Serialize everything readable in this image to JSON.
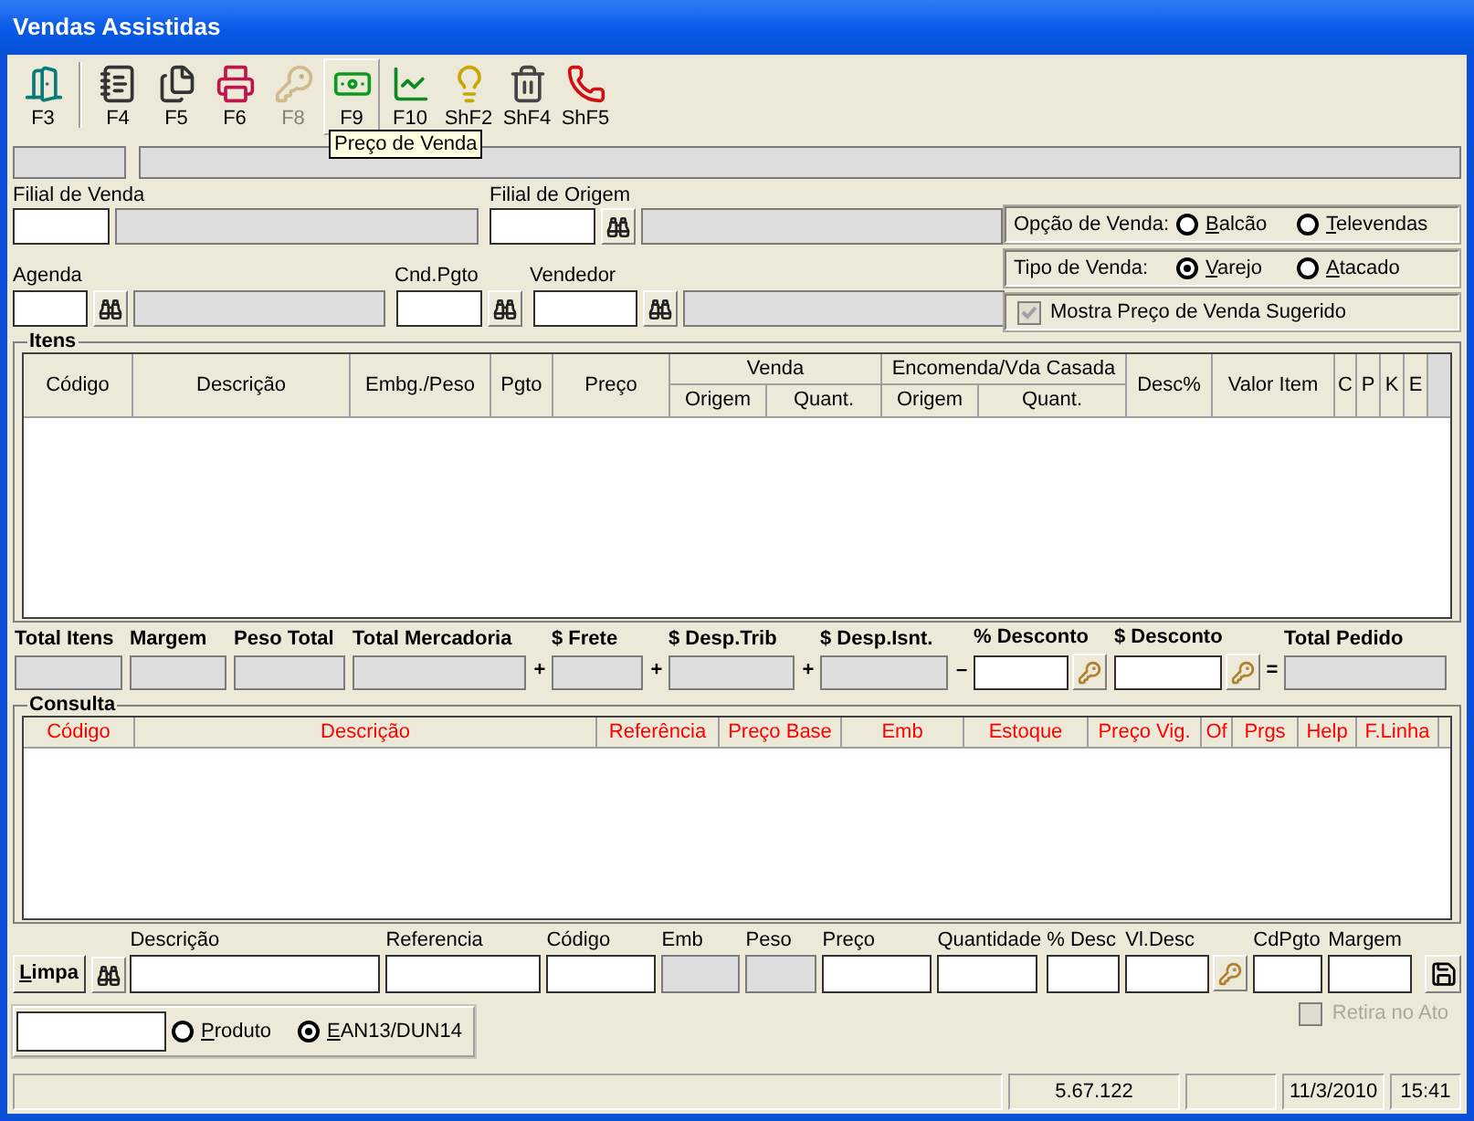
{
  "window": {
    "title": "Vendas Assistidas"
  },
  "toolbar": [
    {
      "label": "F3",
      "disabled": false,
      "hovered": false
    },
    {
      "label": "F4",
      "disabled": false,
      "hovered": false
    },
    {
      "label": "F5",
      "disabled": false,
      "hovered": false
    },
    {
      "label": "F6",
      "disabled": false,
      "hovered": false
    },
    {
      "label": "F8",
      "disabled": true,
      "hovered": false
    },
    {
      "label": "F9",
      "disabled": false,
      "hovered": true
    },
    {
      "label": "F10",
      "disabled": false,
      "hovered": false
    },
    {
      "label": "ShF2",
      "disabled": false,
      "hovered": false
    },
    {
      "label": "ShF4",
      "disabled": false,
      "hovered": false
    },
    {
      "label": "ShF5",
      "disabled": false,
      "hovered": false
    }
  ],
  "tooltip": "Preço de Venda",
  "filial_venda": {
    "label": "Filial de Venda"
  },
  "filial_origem": {
    "label": "Filial de Origem"
  },
  "agenda": {
    "label": "Agenda"
  },
  "cnd_pgto": {
    "label": "Cnd.Pgto"
  },
  "vendedor": {
    "label": "Vendedor"
  },
  "opcao_venda": {
    "label": "Opção de Venda:",
    "options": [
      {
        "label": "Balcão",
        "selected": false
      },
      {
        "label": "Televendas",
        "selected": false
      }
    ]
  },
  "tipo_venda": {
    "label": "Tipo de Venda:",
    "options": [
      {
        "label": "Varejo",
        "selected": true
      },
      {
        "label": "Atacado",
        "selected": false
      }
    ]
  },
  "mostra_preco": {
    "label": "Mostra Preço de Venda Sugerido",
    "checked": true,
    "disabled": true
  },
  "itens": {
    "title": "Itens",
    "columns": [
      {
        "label": "Código"
      },
      {
        "label": "Descrição"
      },
      {
        "label": "Embg./Peso"
      },
      {
        "label": "Pgto"
      },
      {
        "label": "Preço"
      },
      {
        "label": "Venda",
        "children": [
          {
            "label": "Origem"
          },
          {
            "label": "Quant."
          }
        ]
      },
      {
        "label": "Encomenda/Vda Casada",
        "children": [
          {
            "label": "Origem"
          },
          {
            "label": "Quant."
          }
        ]
      },
      {
        "label": "Desc%"
      },
      {
        "label": "Valor Item"
      },
      {
        "label": "C"
      },
      {
        "label": "P"
      },
      {
        "label": "K"
      },
      {
        "label": "E"
      }
    ]
  },
  "totals": [
    {
      "label": "Total Itens",
      "kind": "readonly"
    },
    {
      "label": "Margem",
      "kind": "readonly"
    },
    {
      "label": "Peso Total",
      "kind": "readonly"
    },
    {
      "label": "Total Mercadoria",
      "kind": "readonly"
    },
    {
      "label": "$ Frete",
      "kind": "readonly",
      "operator": "+"
    },
    {
      "label": "$ Desp.Trib",
      "kind": "readonly",
      "operator": "+"
    },
    {
      "label": "$ Desp.Isnt.",
      "kind": "readonly",
      "operator": "+"
    },
    {
      "label": "% Desconto",
      "kind": "input_key",
      "operator": "–"
    },
    {
      "label": "$ Desconto",
      "kind": "input_key"
    },
    {
      "label": "Total Pedido",
      "kind": "readonly",
      "operator": "="
    }
  ],
  "consulta": {
    "title": "Consulta",
    "columns": [
      {
        "label": "Código"
      },
      {
        "label": "Descrição"
      },
      {
        "label": "Referência"
      },
      {
        "label": "Preço Base"
      },
      {
        "label": "Emb"
      },
      {
        "label": "Estoque"
      },
      {
        "label": "Preço Vig."
      },
      {
        "label": "Of"
      },
      {
        "label": "Prgs"
      },
      {
        "label": "Help"
      },
      {
        "label": "F.Linha"
      }
    ]
  },
  "entry": {
    "button": "Limpa",
    "fields": [
      {
        "label": "Descrição",
        "kind": "input"
      },
      {
        "label": "Referencia",
        "kind": "input"
      },
      {
        "label": "Código",
        "kind": "input"
      },
      {
        "label": "Emb",
        "kind": "readonly"
      },
      {
        "label": "Peso",
        "kind": "readonly"
      },
      {
        "label": "Preço",
        "kind": "input"
      },
      {
        "label": "Quantidade",
        "kind": "input"
      },
      {
        "label": "% Desc",
        "kind": "input"
      },
      {
        "label": "Vl.Desc",
        "kind": "input_key"
      },
      {
        "label": "CdPgto",
        "kind": "input"
      },
      {
        "label": "Margem",
        "kind": "input"
      }
    ]
  },
  "retira": {
    "label": "Retira no Ato",
    "checked": false,
    "disabled": true
  },
  "search_mode": {
    "options": [
      {
        "label": "Produto",
        "selected": false
      },
      {
        "label": "EAN13/DUN14",
        "selected": true
      }
    ]
  },
  "status_bar": {
    "version": "5.67.122",
    "date": "11/3/2010",
    "time": "15:41"
  }
}
